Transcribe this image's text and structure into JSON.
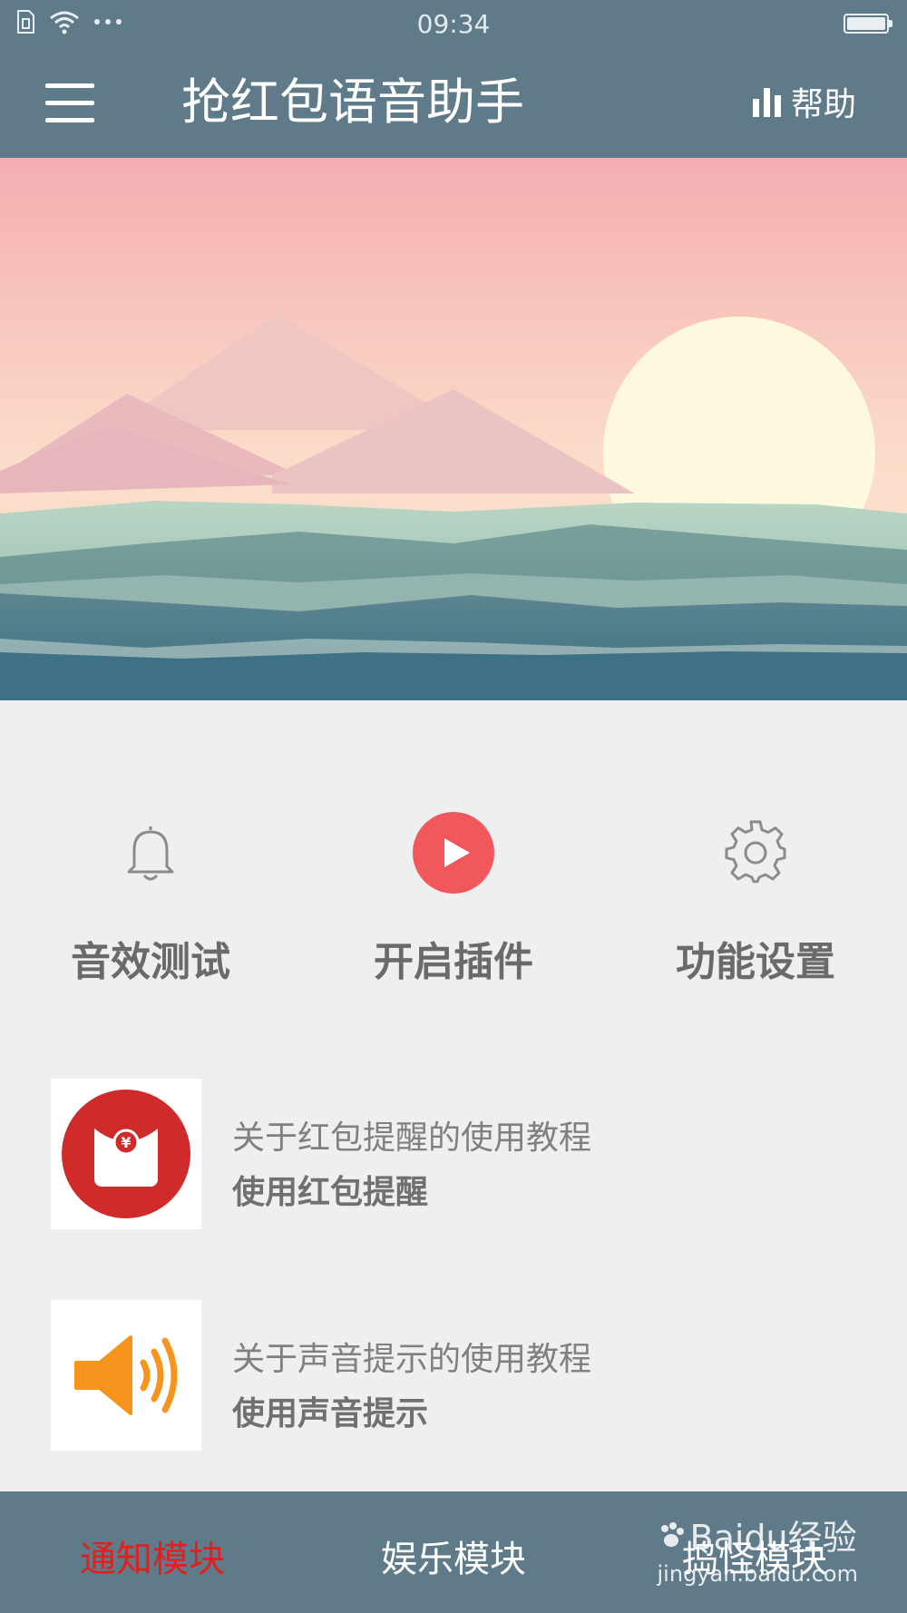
{
  "status_bar": {
    "time": "09:34",
    "icons": [
      "sim-icon",
      "wifi-icon",
      "more-dots-icon",
      "battery-icon"
    ]
  },
  "app_bar": {
    "menu_icon": "hamburger-menu-icon",
    "title": "抢红包语音助手",
    "help_icon": "bar-chart-icon",
    "help_label": "帮助"
  },
  "banner": {
    "image": "sunset-mountains-sea-illustration"
  },
  "actions": [
    {
      "icon": "bell-icon",
      "label": "音效测试"
    },
    {
      "icon": "play-icon",
      "label": "开启插件",
      "accent": "#f2575e"
    },
    {
      "icon": "gear-icon",
      "label": "功能设置"
    }
  ],
  "tutorials": [
    {
      "icon": "red-envelope-icon",
      "title": "关于红包提醒的使用教程",
      "action": "使用红包提醒",
      "icon_color": "#cf2b2b"
    },
    {
      "icon": "speaker-icon",
      "title": "关于声音提示的使用教程",
      "action": "使用声音提示",
      "icon_color": "#f7941d"
    }
  ],
  "bottom_nav": {
    "tabs": [
      "通知模块",
      "娱乐模块",
      "捣怪模块"
    ],
    "active_tab": "通知模块",
    "active_color": "#e02020"
  },
  "watermark": {
    "text": "Baidu经验",
    "url": "jingyan.baidu.com"
  }
}
